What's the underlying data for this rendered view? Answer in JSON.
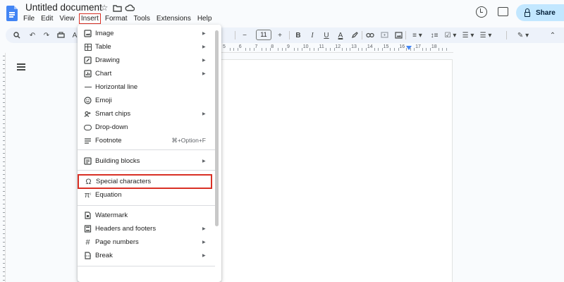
{
  "app": {
    "doc_title": "Untitled document",
    "share_label": "Share"
  },
  "menubar": {
    "items": [
      "File",
      "Edit",
      "View",
      "Insert",
      "Format",
      "Tools",
      "Extensions",
      "Help"
    ],
    "active": "Insert"
  },
  "toolbar": {
    "font_size": "11",
    "minus": "−",
    "plus": "+",
    "bold": "B",
    "italic": "I",
    "underline": "U",
    "text_color": "A"
  },
  "ruler": {
    "numbers": [
      "5",
      "6",
      "7",
      "8",
      "9",
      "10",
      "11",
      "12",
      "13",
      "14",
      "15",
      "16",
      "17",
      "18"
    ]
  },
  "insert_menu": {
    "items": [
      {
        "label": "Image",
        "icon": "image-icon",
        "submenu": true
      },
      {
        "label": "Table",
        "icon": "table-icon",
        "submenu": true
      },
      {
        "label": "Drawing",
        "icon": "drawing-icon",
        "submenu": true
      },
      {
        "label": "Chart",
        "icon": "chart-icon",
        "submenu": true
      },
      {
        "label": "Horizontal line",
        "icon": "horizontal-line-icon",
        "submenu": false
      },
      {
        "label": "Emoji",
        "icon": "emoji-icon",
        "submenu": false
      },
      {
        "label": "Smart chips",
        "icon": "smart-chips-icon",
        "submenu": true
      },
      {
        "label": "Drop-down",
        "icon": "dropdown-icon",
        "submenu": false
      },
      {
        "label": "Footnote",
        "icon": "footnote-icon",
        "submenu": false,
        "shortcut": "⌘+Option+F"
      },
      {
        "label": "Building blocks",
        "icon": "building-blocks-icon",
        "submenu": true
      },
      {
        "label": "Special characters",
        "icon": "omega-icon",
        "submenu": false,
        "highlighted": true
      },
      {
        "label": "Equation",
        "icon": "pi-icon",
        "submenu": false
      },
      {
        "label": "Watermark",
        "icon": "watermark-icon",
        "submenu": false
      },
      {
        "label": "Headers and footers",
        "icon": "headers-footers-icon",
        "submenu": true
      },
      {
        "label": "Page numbers",
        "icon": "hash-icon",
        "submenu": true
      },
      {
        "label": "Break",
        "icon": "break-icon",
        "submenu": true
      }
    ]
  },
  "colors": {
    "accent": "#c2e7ff",
    "highlight_border": "#d93025",
    "brand_blue": "#4285f4"
  }
}
